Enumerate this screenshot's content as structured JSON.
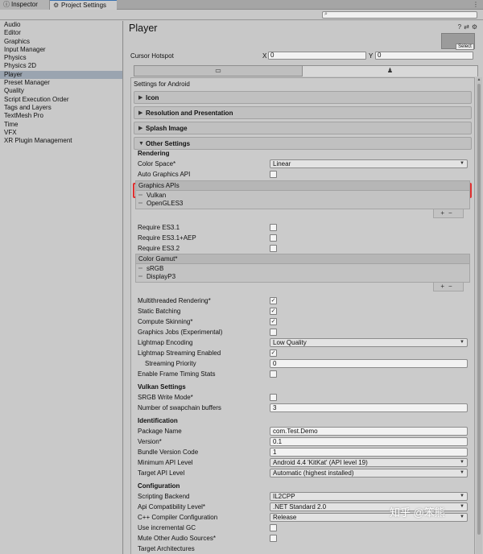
{
  "tabs": [
    {
      "label": "Inspector",
      "icon": "info-icon",
      "active": false
    },
    {
      "label": "Project Settings",
      "icon": "gear-icon",
      "active": true
    }
  ],
  "categories": [
    "Audio",
    "Editor",
    "Graphics",
    "Input Manager",
    "Physics",
    "Physics 2D",
    "Player",
    "Preset Manager",
    "Quality",
    "Script Execution Order",
    "Tags and Layers",
    "TextMesh Pro",
    "Time",
    "VFX",
    "XR Plugin Management"
  ],
  "selected_category": "Player",
  "header": {
    "title": "Player",
    "select_label": "Select"
  },
  "cursor": {
    "label": "Cursor Hotspot",
    "x_label": "X",
    "x": "0",
    "y_label": "Y",
    "y": "0"
  },
  "platform_tabs": [
    {
      "icon": "monitor-icon"
    },
    {
      "icon": "android-icon"
    }
  ],
  "settings_for": "Settings for Android",
  "foldouts": {
    "icon": "Icon",
    "resolution": "Resolution and Presentation",
    "splash": "Splash Image",
    "other": "Other Settings"
  },
  "rendering": {
    "section": "Rendering",
    "color_space_label": "Color Space*",
    "color_space": "Linear",
    "auto_api_label": "Auto Graphics API",
    "graphics_apis_header": "Graphics APIs",
    "graphics_apis": [
      "Vulkan",
      "OpenGLES3"
    ],
    "es31": "Require ES3.1",
    "es31aep": "Require ES3.1+AEP",
    "es32": "Require ES3.2",
    "gamut_header": "Color Gamut*",
    "gamut": [
      "sRGB",
      "DisplayP3"
    ],
    "multithreaded": "Multithreaded Rendering*",
    "static_batching": "Static Batching",
    "compute_skinning": "Compute Skinning*",
    "graphics_jobs": "Graphics Jobs (Experimental)",
    "lightmap_encoding_label": "Lightmap Encoding",
    "lightmap_encoding": "Low Quality",
    "lightmap_streaming": "Lightmap Streaming Enabled",
    "streaming_priority_label": "Streaming Priority",
    "streaming_priority": "0",
    "frame_timing": "Enable Frame Timing Stats"
  },
  "vulkan": {
    "section": "Vulkan Settings",
    "srgb_write": "SRGB Write Mode*",
    "swapchain_label": "Number of swapchain buffers",
    "swapchain": "3"
  },
  "identification": {
    "section": "Identification",
    "package_label": "Package Name",
    "package": "com.Test.Demo",
    "version_label": "Version*",
    "version": "0.1",
    "bundle_label": "Bundle Version Code",
    "bundle": "1",
    "min_api_label": "Minimum API Level",
    "min_api": "Android 4.4 'KitKat' (API level 19)",
    "target_api_label": "Target API Level",
    "target_api": "Automatic (highest installed)"
  },
  "configuration": {
    "section": "Configuration",
    "backend_label": "Scripting Backend",
    "backend": "IL2CPP",
    "api_compat_label": "Api Compatibility Level*",
    "api_compat": ".NET Standard 2.0",
    "cpp_label": "C++ Compiler Configuration",
    "cpp": "Release",
    "incremental_gc": "Use incremental GC",
    "mute_audio": "Mute Other Audio Sources*",
    "target_arch": "Target Architectures"
  },
  "watermark": "知乎 @笨熊",
  "colors": {
    "highlight": "#e03030",
    "selection": "#9aa4b0"
  }
}
